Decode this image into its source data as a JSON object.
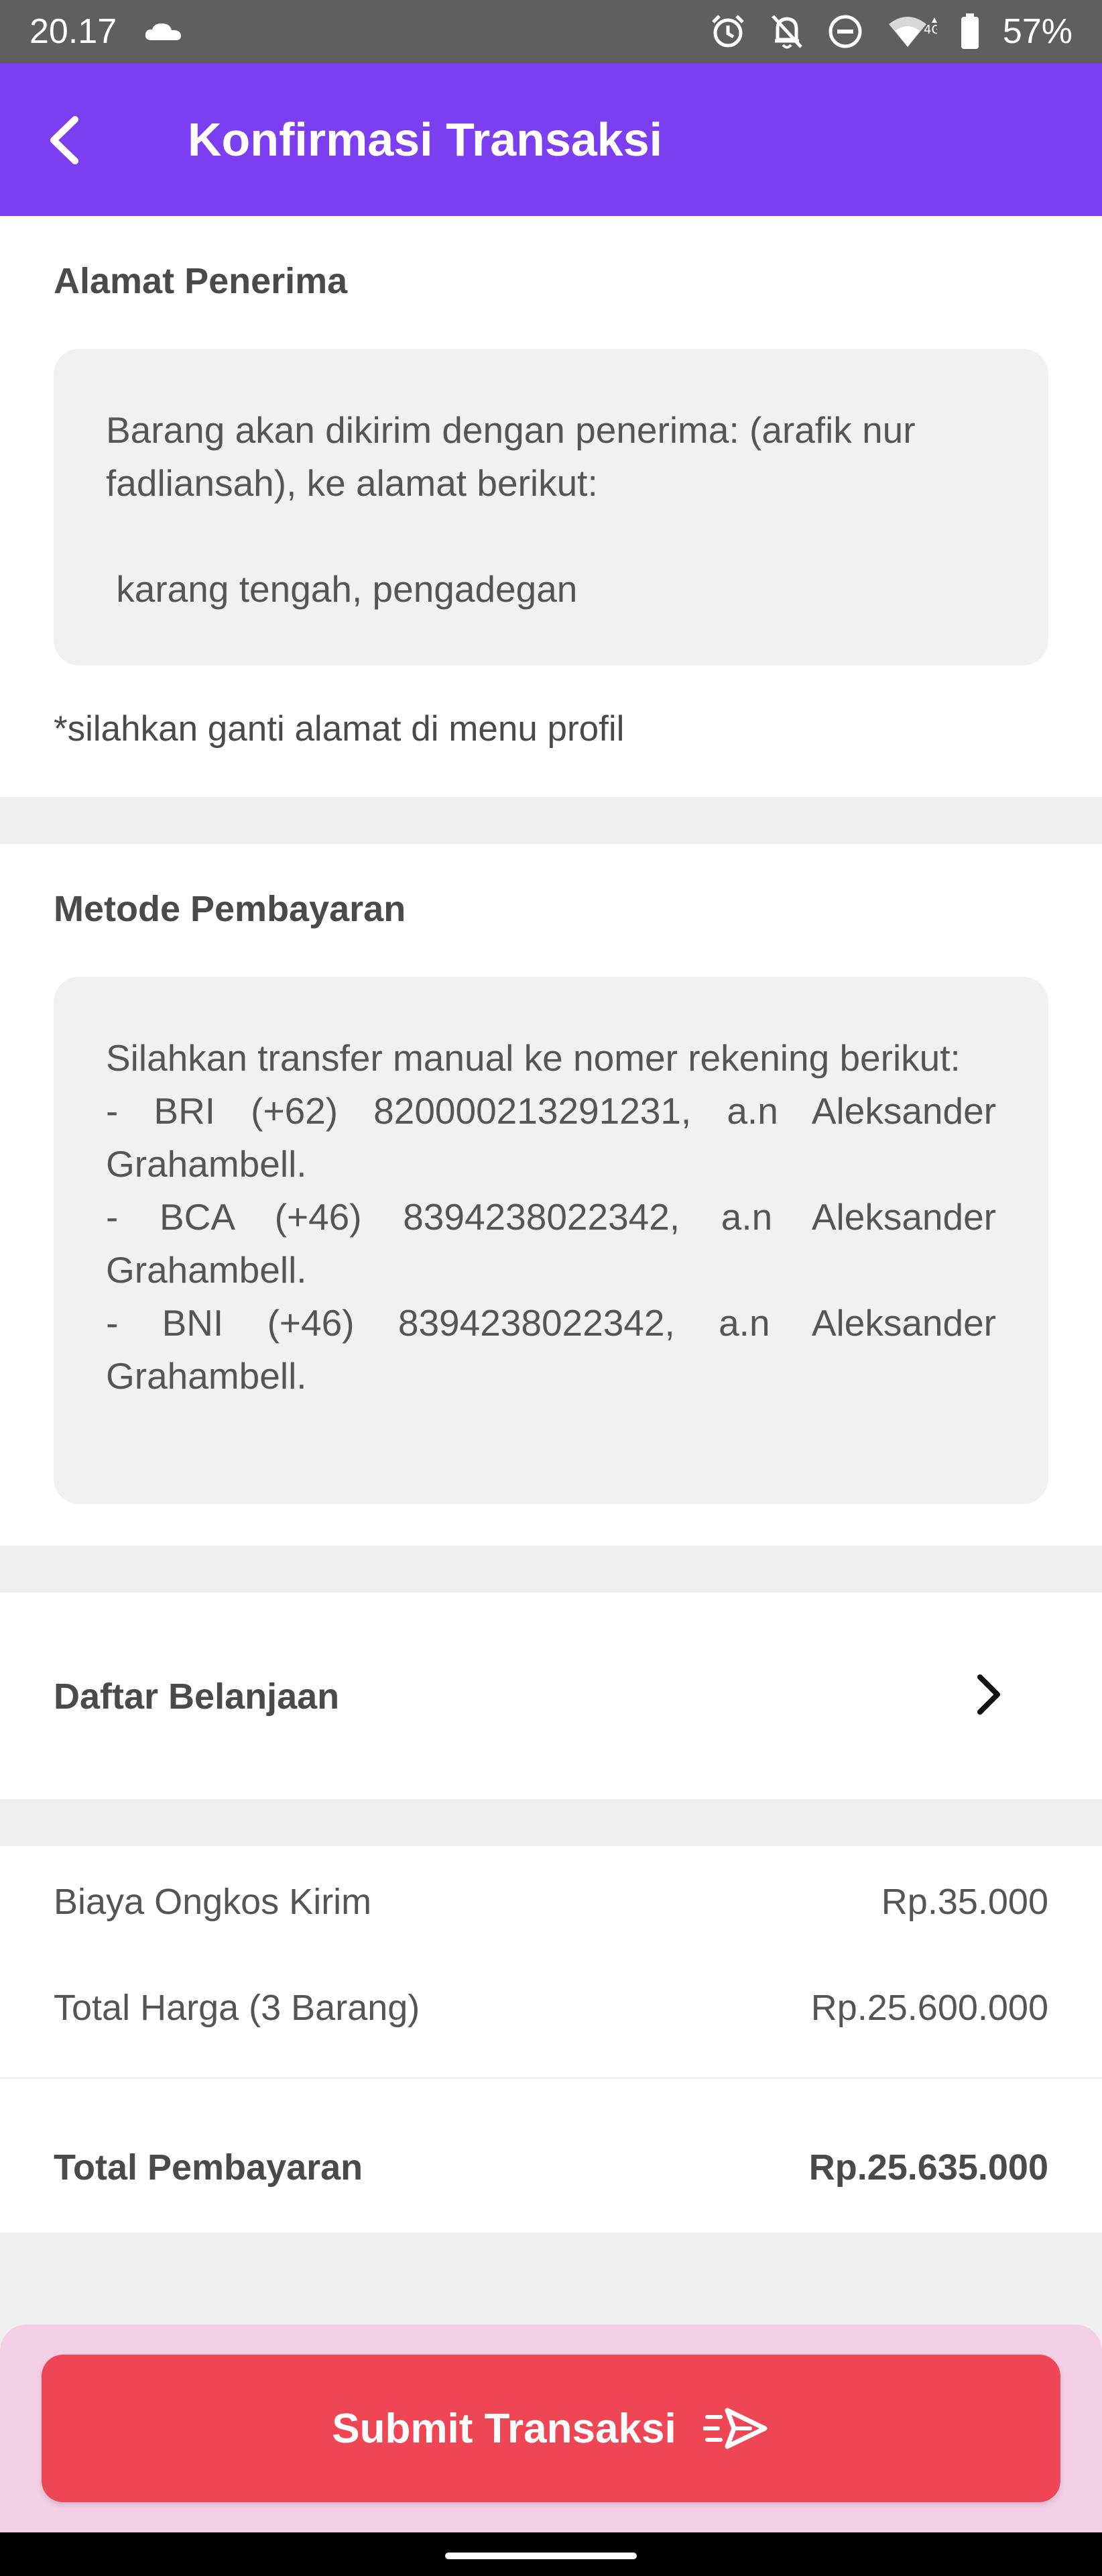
{
  "status_bar": {
    "time": "20.17",
    "battery": "57%",
    "icons": [
      "cloud-icon",
      "alarm-icon",
      "bell-off-icon",
      "dnd-icon",
      "wifi-icon",
      "battery-icon"
    ]
  },
  "app_bar": {
    "title": "Konfirmasi Transaksi",
    "back_icon": "chevron-left-icon",
    "color": "#7b3ef0"
  },
  "address": {
    "title": "Alamat Penerima",
    "line1": "Barang akan dikirim dengan penerima: (arafik nur fadliansah), ke alamat berikut:",
    "line2": " karang tengah, pengadegan",
    "note": "*silahkan ganti alamat di menu profil"
  },
  "payment": {
    "title": "Metode Pembayaran",
    "lines": [
      "Silahkan transfer manual ke nomer rekening berikut:",
      "- BRI (+62) 820000213291231, a.n Aleksander Grahambell.",
      "- BCA (+46) 8394238022342, a.n Aleksander Grahambell.",
      "- BNI (+46) 8394238022342, a.n Aleksander Grahambell."
    ]
  },
  "shopping_list": {
    "label": "Daftar Belanjaan",
    "icon": "chevron-right-icon"
  },
  "summary": {
    "shipping_label": "Biaya Ongkos Kirim",
    "shipping_value": "Rp.35.000",
    "items_label": "Total Harga (3 Barang)",
    "items_value": "Rp.25.600.000",
    "total_label": "Total Pembayaran",
    "total_value": "Rp.25.635.000"
  },
  "submit": {
    "label": "Submit Transaksi",
    "icon": "send-icon",
    "color": "#ef4655"
  }
}
